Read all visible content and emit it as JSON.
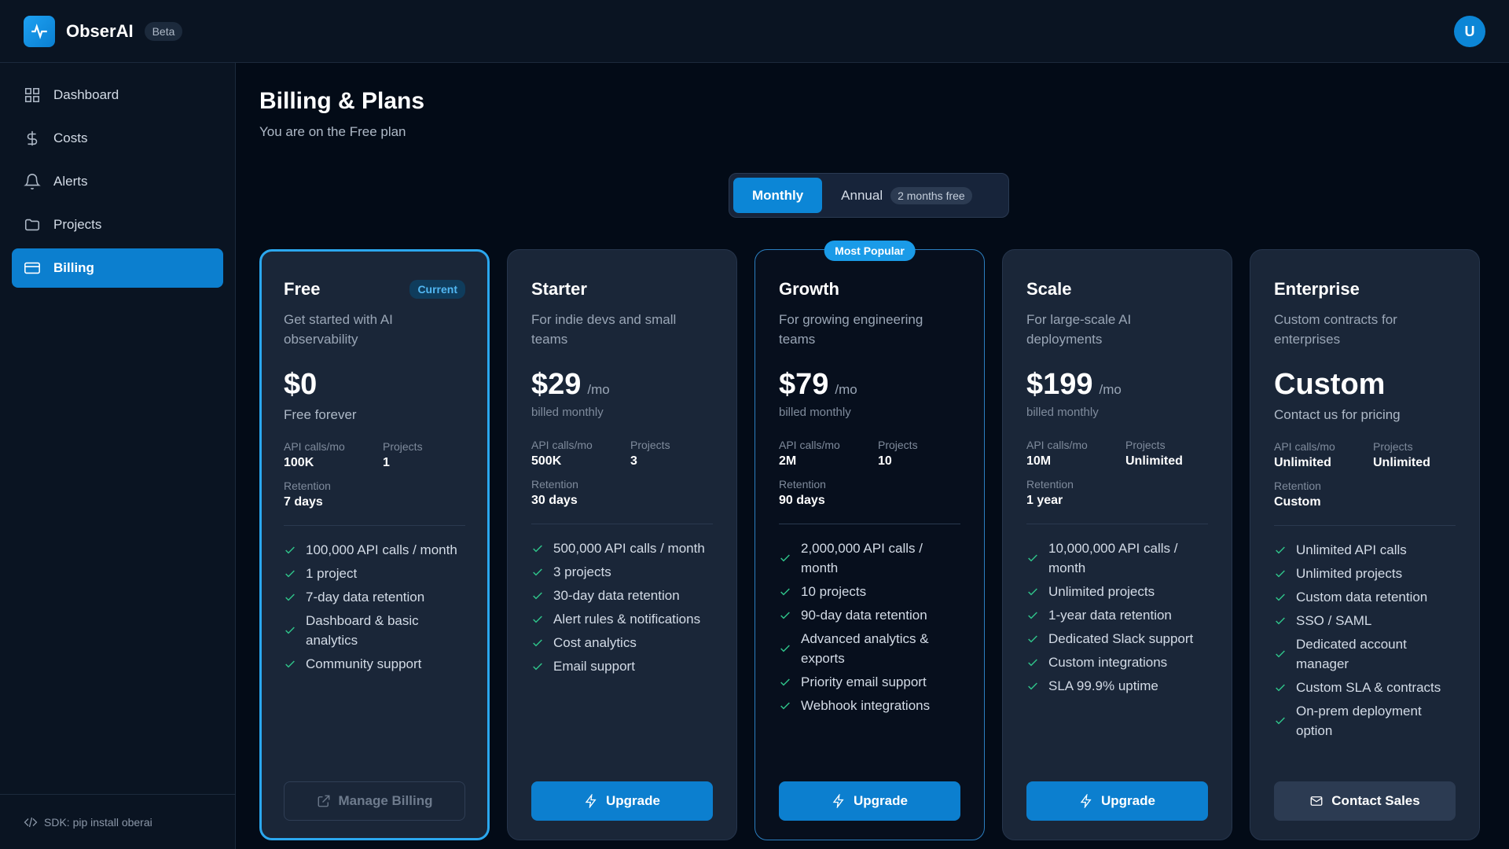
{
  "app": {
    "name": "ObserAI",
    "badge": "Beta",
    "user_initial": "U"
  },
  "sidebar": {
    "items": [
      {
        "label": "Dashboard",
        "icon": "grid-icon"
      },
      {
        "label": "Costs",
        "icon": "dollar-icon"
      },
      {
        "label": "Alerts",
        "icon": "bell-icon"
      },
      {
        "label": "Projects",
        "icon": "folder-icon"
      },
      {
        "label": "Billing",
        "icon": "credit-card-icon",
        "active": true
      }
    ],
    "sdk_hint": "SDK: pip install oberai"
  },
  "page": {
    "title": "Billing & Plans",
    "subtitle": "You are on the Free plan"
  },
  "billing_toggle": {
    "monthly": "Monthly",
    "annual": "Annual",
    "annual_badge": "2 months free",
    "selected": "Monthly"
  },
  "stat_labels": {
    "api": "API calls/mo",
    "projects": "Projects",
    "retention": "Retention"
  },
  "plans": [
    {
      "name": "Free",
      "badge": "Current",
      "description": "Get started with AI observability",
      "price": "$0",
      "period": "",
      "note": "Free forever",
      "api": "100K",
      "projects": "1",
      "retention": "7 days",
      "features": [
        "100,000 API calls / month",
        "1 project",
        "7-day data retention",
        "Dashboard & basic analytics",
        "Community support"
      ],
      "button": "Manage Billing"
    },
    {
      "name": "Starter",
      "description": "For indie devs and small teams",
      "price": "$29",
      "period": "/mo",
      "note": "billed monthly",
      "api": "500K",
      "projects": "3",
      "retention": "30 days",
      "features": [
        "500,000 API calls / month",
        "3 projects",
        "30-day data retention",
        "Alert rules & notifications",
        "Cost analytics",
        "Email support"
      ],
      "button": "Upgrade"
    },
    {
      "name": "Growth",
      "highlight": "Most Popular",
      "description": "For growing engineering teams",
      "price": "$79",
      "period": "/mo",
      "note": "billed monthly",
      "api": "2M",
      "projects": "10",
      "retention": "90 days",
      "features": [
        "2,000,000 API calls / month",
        "10 projects",
        "90-day data retention",
        "Advanced analytics & exports",
        "Priority email support",
        "Webhook integrations"
      ],
      "button": "Upgrade"
    },
    {
      "name": "Scale",
      "description": "For large-scale AI deployments",
      "price": "$199",
      "period": "/mo",
      "note": "billed monthly",
      "api": "10M",
      "projects": "Unlimited",
      "retention": "1 year",
      "features": [
        "10,000,000 API calls / month",
        "Unlimited projects",
        "1-year data retention",
        "Dedicated Slack support",
        "Custom integrations",
        "SLA 99.9% uptime"
      ],
      "button": "Upgrade"
    },
    {
      "name": "Enterprise",
      "description": "Custom contracts for enterprises",
      "price": "Custom",
      "period": "",
      "note": "Contact us for pricing",
      "api": "Unlimited",
      "projects": "Unlimited",
      "retention": "Custom",
      "features": [
        "Unlimited API calls",
        "Unlimited projects",
        "Custom data retention",
        "SSO / SAML",
        "Dedicated account manager",
        "Custom SLA & contracts",
        "On-prem deployment option"
      ],
      "button": "Contact Sales"
    }
  ],
  "colors": {
    "accent": "#0c86d6",
    "check": "#2fc48a",
    "background": "#030b17",
    "card": "#1a2638"
  }
}
